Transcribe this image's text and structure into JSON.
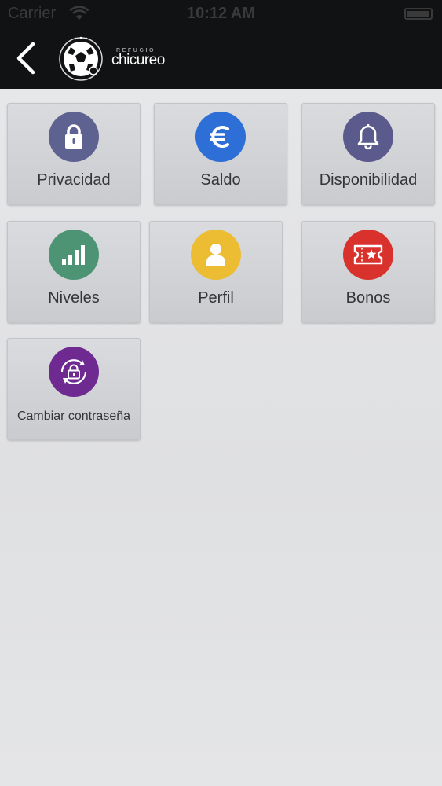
{
  "status_bar": {
    "carrier": "Carrier",
    "time": "10:12 AM"
  },
  "header": {
    "back_icon": "chevron-left-icon",
    "logo": {
      "subtitle": "REFUGIO",
      "name": "chicureo",
      "icon": "soccer-ball-icon"
    }
  },
  "colors": {
    "header_bg": "#111213",
    "page_bg": "#e3e4e6",
    "tile_bg": "#d3d5d8",
    "privacidad": "#5e6290",
    "saldo": "#2d6fd6",
    "disponibilidad": "#5a5a8c",
    "niveles": "#4c9474",
    "perfil": "#ecbd32",
    "bonos": "#d9322c",
    "cambiar": "#6f2a92"
  },
  "menu": [
    {
      "id": "privacidad",
      "label": "Privacidad",
      "icon": "lock-icon"
    },
    {
      "id": "saldo",
      "label": "Saldo",
      "icon": "euro-icon"
    },
    {
      "id": "disponibilidad",
      "label": "Disponibilidad",
      "icon": "bell-icon"
    },
    {
      "id": "niveles",
      "label": "Niveles",
      "icon": "signal-bars-icon"
    },
    {
      "id": "perfil",
      "label": "Perfil",
      "icon": "person-icon"
    },
    {
      "id": "bonos",
      "label": "Bonos",
      "icon": "ticket-star-icon"
    },
    {
      "id": "cambiar",
      "label": "Cambiar contraseña",
      "icon": "lock-rotate-icon"
    }
  ]
}
